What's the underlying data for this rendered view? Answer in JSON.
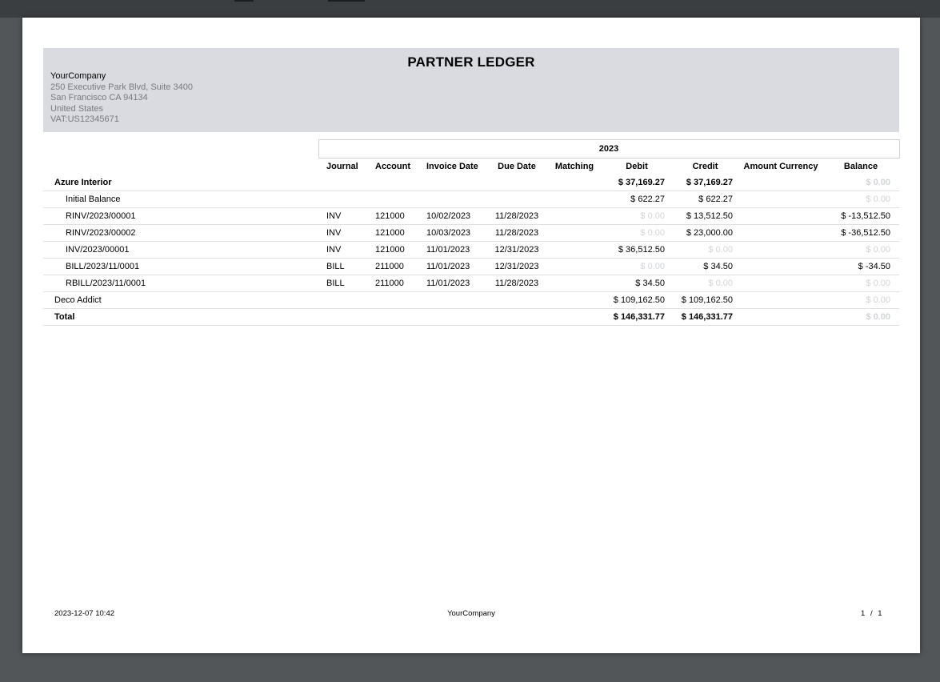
{
  "report": {
    "title": "PARTNER LEDGER",
    "company": {
      "name": "YourCompany",
      "address_lines": [
        "250 Executive Park Blvd, Suite 3400",
        "San Francisco CA 94134",
        "United States",
        "VAT:US12345671"
      ]
    },
    "period": "2023",
    "columns": {
      "journal": "Journal",
      "account": "Account",
      "invoice_date": "Invoice Date",
      "due_date": "Due Date",
      "matching": "Matching",
      "debit": "Debit",
      "credit": "Credit",
      "amount_currency": "Amount Currency",
      "balance": "Balance"
    },
    "rows": [
      {
        "name": "Azure Interior",
        "journal": "",
        "account": "",
        "invoice_date": "",
        "due_date": "",
        "matching": "",
        "debit": "$ 37,169.27",
        "credit": "$ 37,169.27",
        "amount_currency": "",
        "balance": "$ 0.00"
      },
      {
        "name": "Initial Balance",
        "journal": "",
        "account": "",
        "invoice_date": "",
        "due_date": "",
        "matching": "",
        "debit": "$ 622.27",
        "credit": "$ 622.27",
        "amount_currency": "",
        "balance": "$ 0.00"
      },
      {
        "name": "RINV/2023/00001",
        "journal": "INV",
        "account": "121000",
        "invoice_date": "10/02/2023",
        "due_date": "11/28/2023",
        "matching": "",
        "debit": "$ 0.00",
        "credit": "$ 13,512.50",
        "amount_currency": "",
        "balance": "$ -13,512.50"
      },
      {
        "name": "RINV/2023/00002",
        "journal": "INV",
        "account": "121000",
        "invoice_date": "10/03/2023",
        "due_date": "11/28/2023",
        "matching": "",
        "debit": "$ 0.00",
        "credit": "$ 23,000.00",
        "amount_currency": "",
        "balance": "$ -36,512.50"
      },
      {
        "name": "INV/2023/00001",
        "journal": "INV",
        "account": "121000",
        "invoice_date": "11/01/2023",
        "due_date": "12/31/2023",
        "matching": "",
        "debit": "$ 36,512.50",
        "credit": "$ 0.00",
        "amount_currency": "",
        "balance": "$ 0.00"
      },
      {
        "name": "BILL/2023/11/0001",
        "journal": "BILL",
        "account": "211000",
        "invoice_date": "11/01/2023",
        "due_date": "12/31/2023",
        "matching": "",
        "debit": "$ 0.00",
        "credit": "$ 34.50",
        "amount_currency": "",
        "balance": "$ -34.50"
      },
      {
        "name": "RBILL/2023/11/0001",
        "journal": "BILL",
        "account": "211000",
        "invoice_date": "11/01/2023",
        "due_date": "11/28/2023",
        "matching": "",
        "debit": "$ 34.50",
        "credit": "$ 0.00",
        "amount_currency": "",
        "balance": "$ 0.00"
      },
      {
        "name": "Deco Addict",
        "journal": "",
        "account": "",
        "invoice_date": "",
        "due_date": "",
        "matching": "",
        "debit": "$ 109,162.50",
        "credit": "$ 109,162.50",
        "amount_currency": "",
        "balance": "$ 0.00"
      }
    ],
    "total": {
      "label": "Total",
      "debit": "$ 146,331.77",
      "credit": "$ 146,331.77",
      "balance": "$ 0.00"
    }
  },
  "footer": {
    "timestamp": "2023-12-07 10:42",
    "company": "YourCompany",
    "page_current": "1",
    "page_sep": "/",
    "page_total": "1"
  },
  "colors": {
    "viewer_background": "#525659",
    "header_band": "#d9dbe0",
    "muted_value": "#d2d4d8",
    "company_address": "#777a80"
  }
}
